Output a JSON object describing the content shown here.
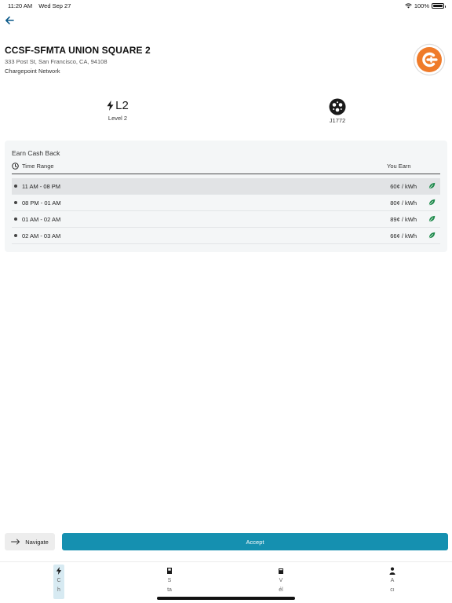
{
  "status": {
    "time": "11:20 AM",
    "date": "Wed Sep 27",
    "battery": "100%"
  },
  "station": {
    "name": "CCSF-SFMTA UNION SQUARE 2",
    "address": "333 Post St, San Francisco, CA, 94108",
    "network": "Chargepoint Network"
  },
  "charger": {
    "level_code": "L2",
    "level_label": "Level 2",
    "connector_label": "J1772"
  },
  "cash_back": {
    "title": "Earn Cash Back",
    "time_range_header": "Time Range",
    "you_earn_header": "You Earn",
    "rows": [
      {
        "time": "11 AM - 08 PM",
        "price": "60¢ / kWh"
      },
      {
        "time": "08 PM - 01 AM",
        "price": "80¢ / kWh"
      },
      {
        "time": "01 AM - 02 AM",
        "price": "89¢ / kWh"
      },
      {
        "time": "02 AM - 03 AM",
        "price": "66¢ / kWh"
      }
    ]
  },
  "actions": {
    "navigate_label": "Navigate",
    "accept_label": "Accept"
  },
  "tabs": [
    {
      "label": "C",
      "sublabel": "h"
    },
    {
      "label": "S",
      "sublabel": "ta"
    },
    {
      "label": "V",
      "sublabel": "él"
    },
    {
      "label": "A",
      "sublabel": "cı"
    }
  ],
  "colors": {
    "accent": "#1590b0",
    "leaf": "#1f8a4c",
    "brand": "#ef7b2a"
  }
}
